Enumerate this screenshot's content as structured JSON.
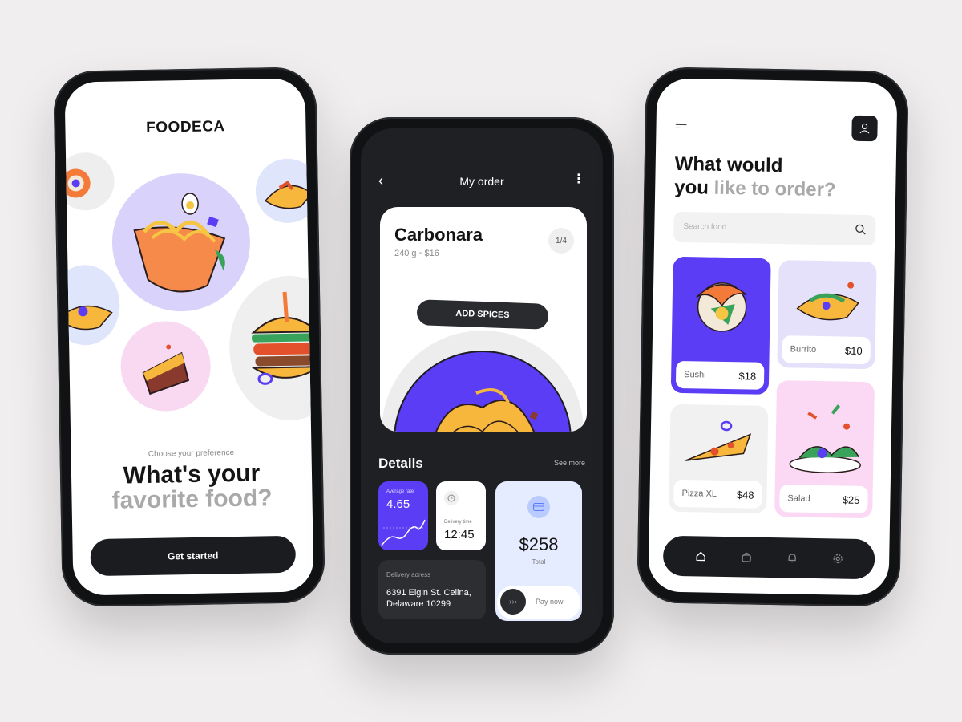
{
  "onboarding": {
    "brand": "FOODECA",
    "preference_label": "Choose your preference",
    "title_line1": "What's your",
    "title_line2": "favorite food?",
    "cta": "Get started"
  },
  "order": {
    "header": {
      "title": "My order"
    },
    "dish": {
      "name": "Carbonara",
      "weight": "240 g",
      "price": "$16",
      "page": "1/4",
      "spices_label": "ADD SPICES"
    },
    "details": {
      "title": "Details",
      "see_more": "See more",
      "rate": {
        "label": "Average rate",
        "value": "4.65"
      },
      "delivery_time": {
        "label": "Delivery time",
        "value": "12:45"
      },
      "address": {
        "label": "Delivery adress",
        "line1": "6391 Elgin St. Celina,",
        "line2": "Delaware 10299"
      },
      "total": {
        "value": "$258",
        "label": "Total",
        "pay_label": "Pay now"
      }
    }
  },
  "menu": {
    "title_line1": "What would",
    "title_you": "you",
    "title_rest": "like to order?",
    "search_placeholder": "Search food",
    "items": [
      {
        "name": "Sushi",
        "price": "$18",
        "bg": "#5b3df5",
        "icon": "sushi-illustration"
      },
      {
        "name": "Burrito",
        "price": "$10",
        "bg": "#e6e1fb",
        "icon": "burrito-illustration"
      },
      {
        "name": "Pizza XL",
        "price": "$48",
        "bg": "#f1f1f1",
        "icon": "pizza-illustration"
      },
      {
        "name": "Salad",
        "price": "$25",
        "bg": "#fbd9f4",
        "icon": "salad-illustration"
      }
    ],
    "tabs": [
      "home-icon",
      "bag-icon",
      "bell-icon",
      "gear-icon"
    ]
  },
  "colors": {
    "accent": "#5b3df5",
    "dark": "#1b1c1f",
    "card_blue": "#e5ecff",
    "pink": "#fbd9f4"
  }
}
